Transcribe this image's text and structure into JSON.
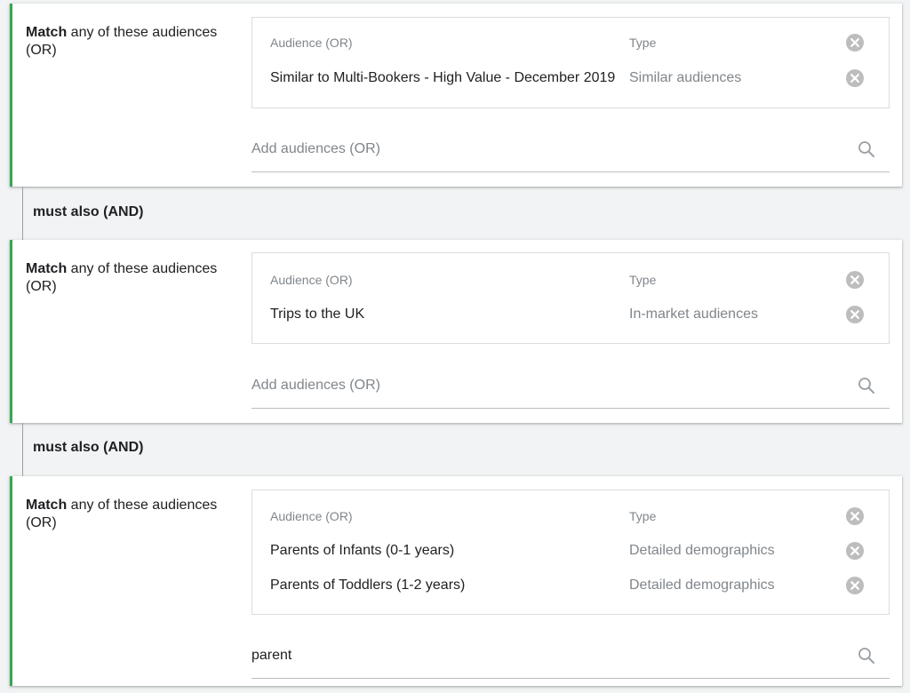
{
  "labels": {
    "match_bold": "Match",
    "match_rest": " any of these audiences (OR)",
    "col_audience": "Audience (OR)",
    "col_type": "Type",
    "and_label": "must also (AND)",
    "add_placeholder": "Add audiences (OR)"
  },
  "groups": [
    {
      "rows": [
        {
          "audience": "Similar to Multi-Bookers - High Value - December 2019",
          "type": "Similar audiences"
        }
      ],
      "search_value": ""
    },
    {
      "rows": [
        {
          "audience": "Trips to the UK",
          "type": "In-market audiences"
        }
      ],
      "search_value": ""
    },
    {
      "rows": [
        {
          "audience": "Parents of Infants (0-1 years)",
          "type": "Detailed demographics"
        },
        {
          "audience": "Parents of Toddlers (1-2 years)",
          "type": "Detailed demographics"
        }
      ],
      "search_value": "parent"
    }
  ],
  "icons": {
    "remove": "close-circle-icon",
    "search": "search-icon"
  },
  "colors": {
    "accent_border": "#34a853",
    "background": "#f1f3f4",
    "icon_grey": "#bdbdbd"
  }
}
